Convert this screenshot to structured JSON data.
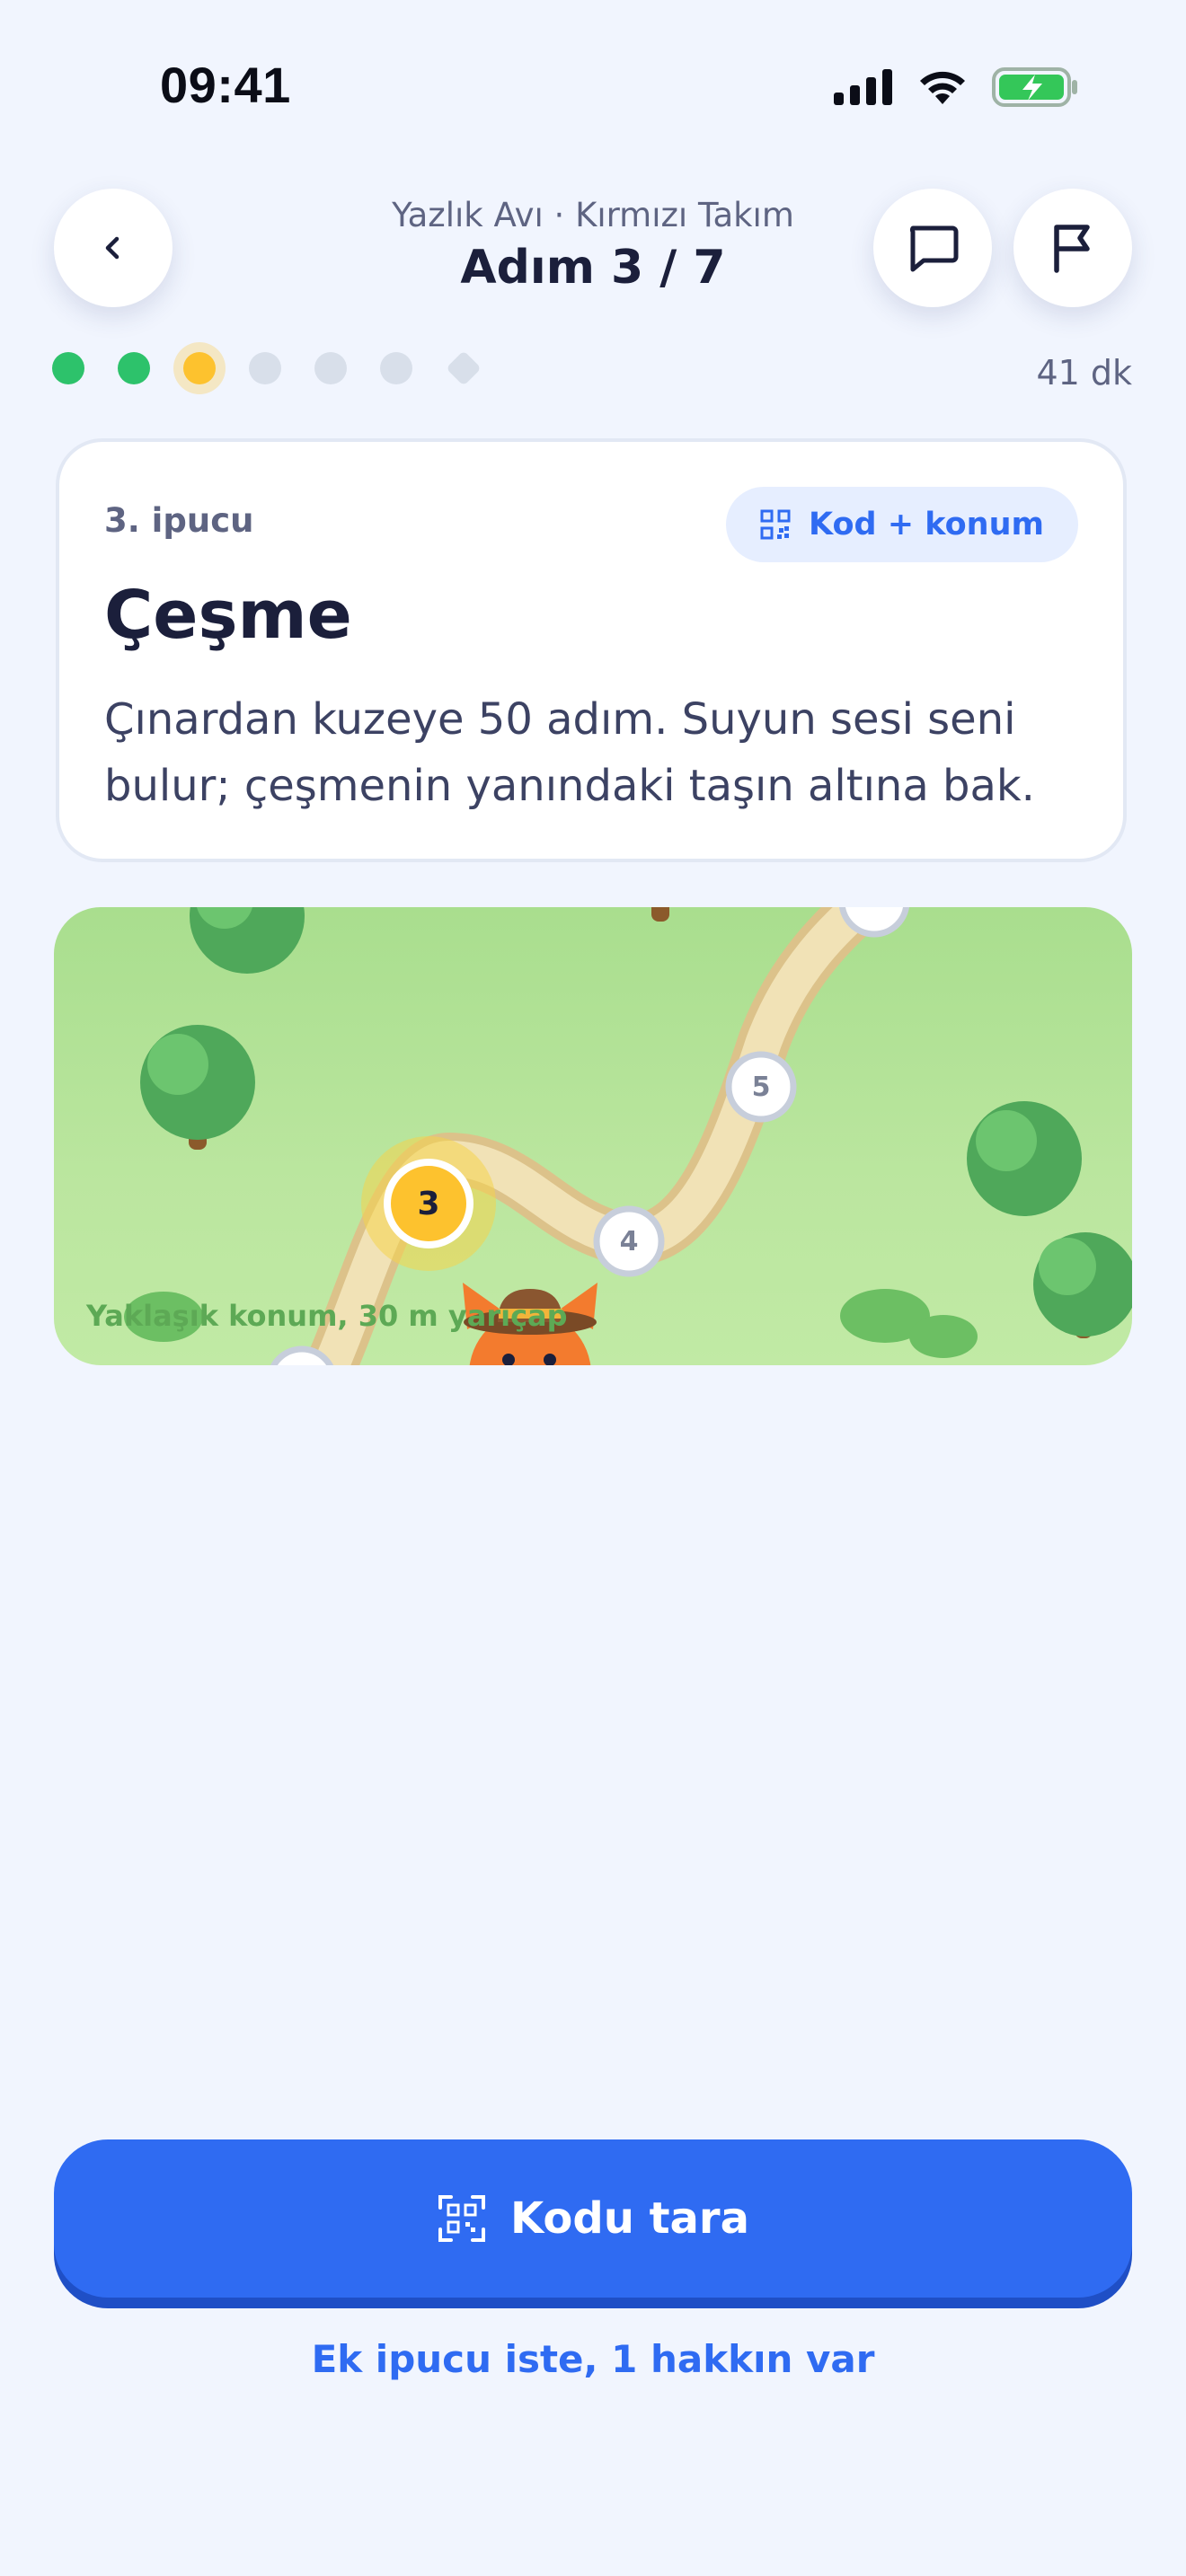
{
  "status_bar": {
    "time": "09:41",
    "icons": [
      "signal-icon",
      "wifi-icon",
      "battery-charging-icon"
    ]
  },
  "header": {
    "subtitle": "Yazlık Avı · Kırmızı Takım",
    "title": "Adım 3 / 7",
    "left_button_icon": "chevron-left-icon",
    "right_buttons": [
      "chat-icon",
      "flag-icon"
    ]
  },
  "progress": {
    "total_steps": 7,
    "completed": 2,
    "current": 3,
    "time_left": "41 dk"
  },
  "clue_card": {
    "clue_number": "3. ipucu",
    "chip_label": "Kod + konum",
    "chip_icon": "qr-code-icon",
    "title": "Çeşme",
    "text": "Çınardan kuzeye 50 adım. Suyun sesi seni bulur; çeşmenin yanındaki taşın altına bak."
  },
  "map": {
    "markers": [
      "3",
      "4",
      "5"
    ],
    "current_marker": "3",
    "caption": "Yaklaşık konum, 30 m yarıçap"
  },
  "actions": {
    "scan_label": "Kodu tara",
    "scan_icon": "qr-scan-icon",
    "hint_link": "Ek ipucu iste, 1 hakkın var"
  },
  "colors": {
    "accent": "#2F6BF2",
    "done": "#2DC26B",
    "current": "#FDC22E",
    "todo": "#D8DFEA",
    "background": "#F1F5FE"
  }
}
